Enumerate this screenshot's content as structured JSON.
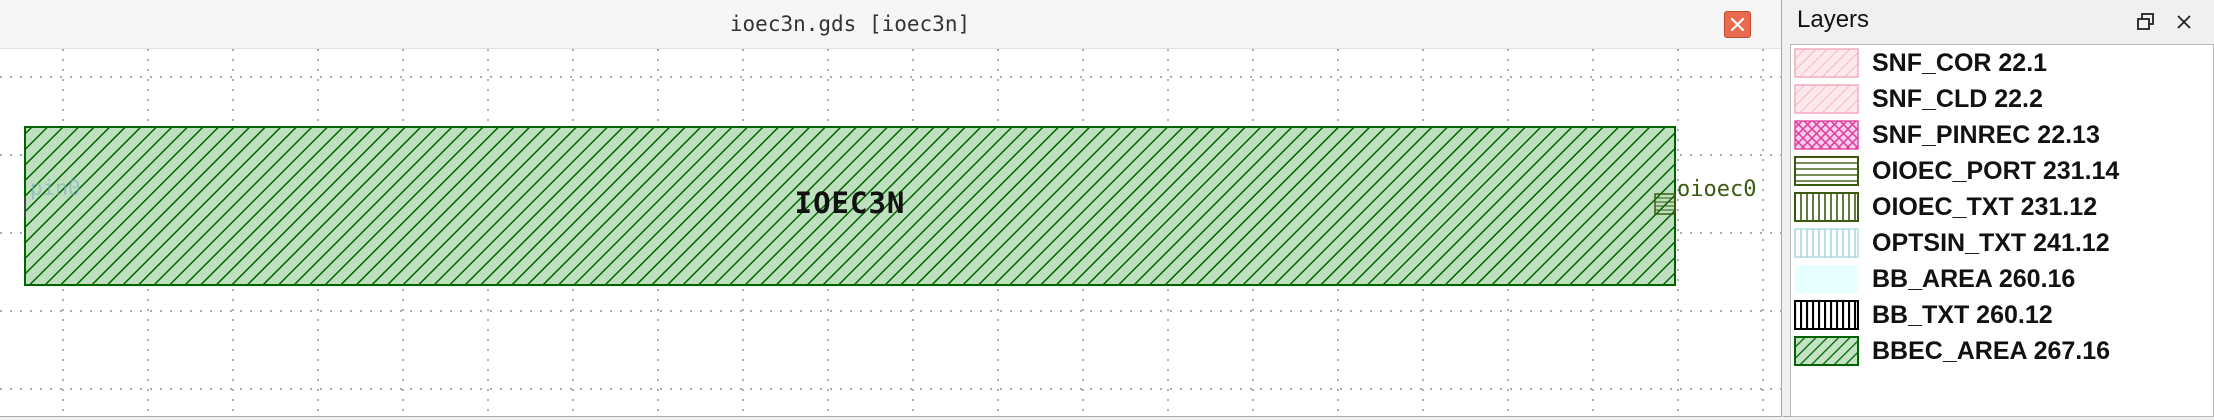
{
  "window": {
    "title": "ioec3n.gds [ioec3n]",
    "close_icon": "close-icon",
    "close_color": "#e96b4f"
  },
  "canvas": {
    "cell_label": "IOEC3N",
    "port_left_label": "pin0",
    "port_right_label": "oioec0",
    "grid": true,
    "background": "#ffffff",
    "cell_fill_color": "#006400"
  },
  "layers_panel": {
    "title": "Layers",
    "float_icon": "restore-window-icon",
    "close_icon": "close-icon",
    "layers": [
      {
        "label": "SNF_COR 22.1",
        "color": "#f4a6b8",
        "pattern": "diag-hatch"
      },
      {
        "label": "SNF_CLD 22.2",
        "color": "#f4a6b8",
        "pattern": "diag-hatch"
      },
      {
        "label": "SNF_PINREC 22.13",
        "color": "#e040a0",
        "pattern": "cross-hatch"
      },
      {
        "label": "OIOEC_PORT 231.14",
        "color": "#3a5a10",
        "pattern": "horizontal-lines"
      },
      {
        "label": "OIOEC_TXT 231.12",
        "color": "#3a5a10",
        "pattern": "vertical-lines"
      },
      {
        "label": "OPTSIN_TXT 241.12",
        "color": "#a8d8e0",
        "pattern": "vertical-lines"
      },
      {
        "label": "BB_AREA 260.16",
        "color": "#e8ffff",
        "pattern": "solid"
      },
      {
        "label": "BB_TXT 260.12",
        "color": "#000000",
        "pattern": "vertical-lines"
      },
      {
        "label": "BBEC_AREA 267.16",
        "color": "#006400",
        "pattern": "diag-hatch"
      }
    ]
  }
}
